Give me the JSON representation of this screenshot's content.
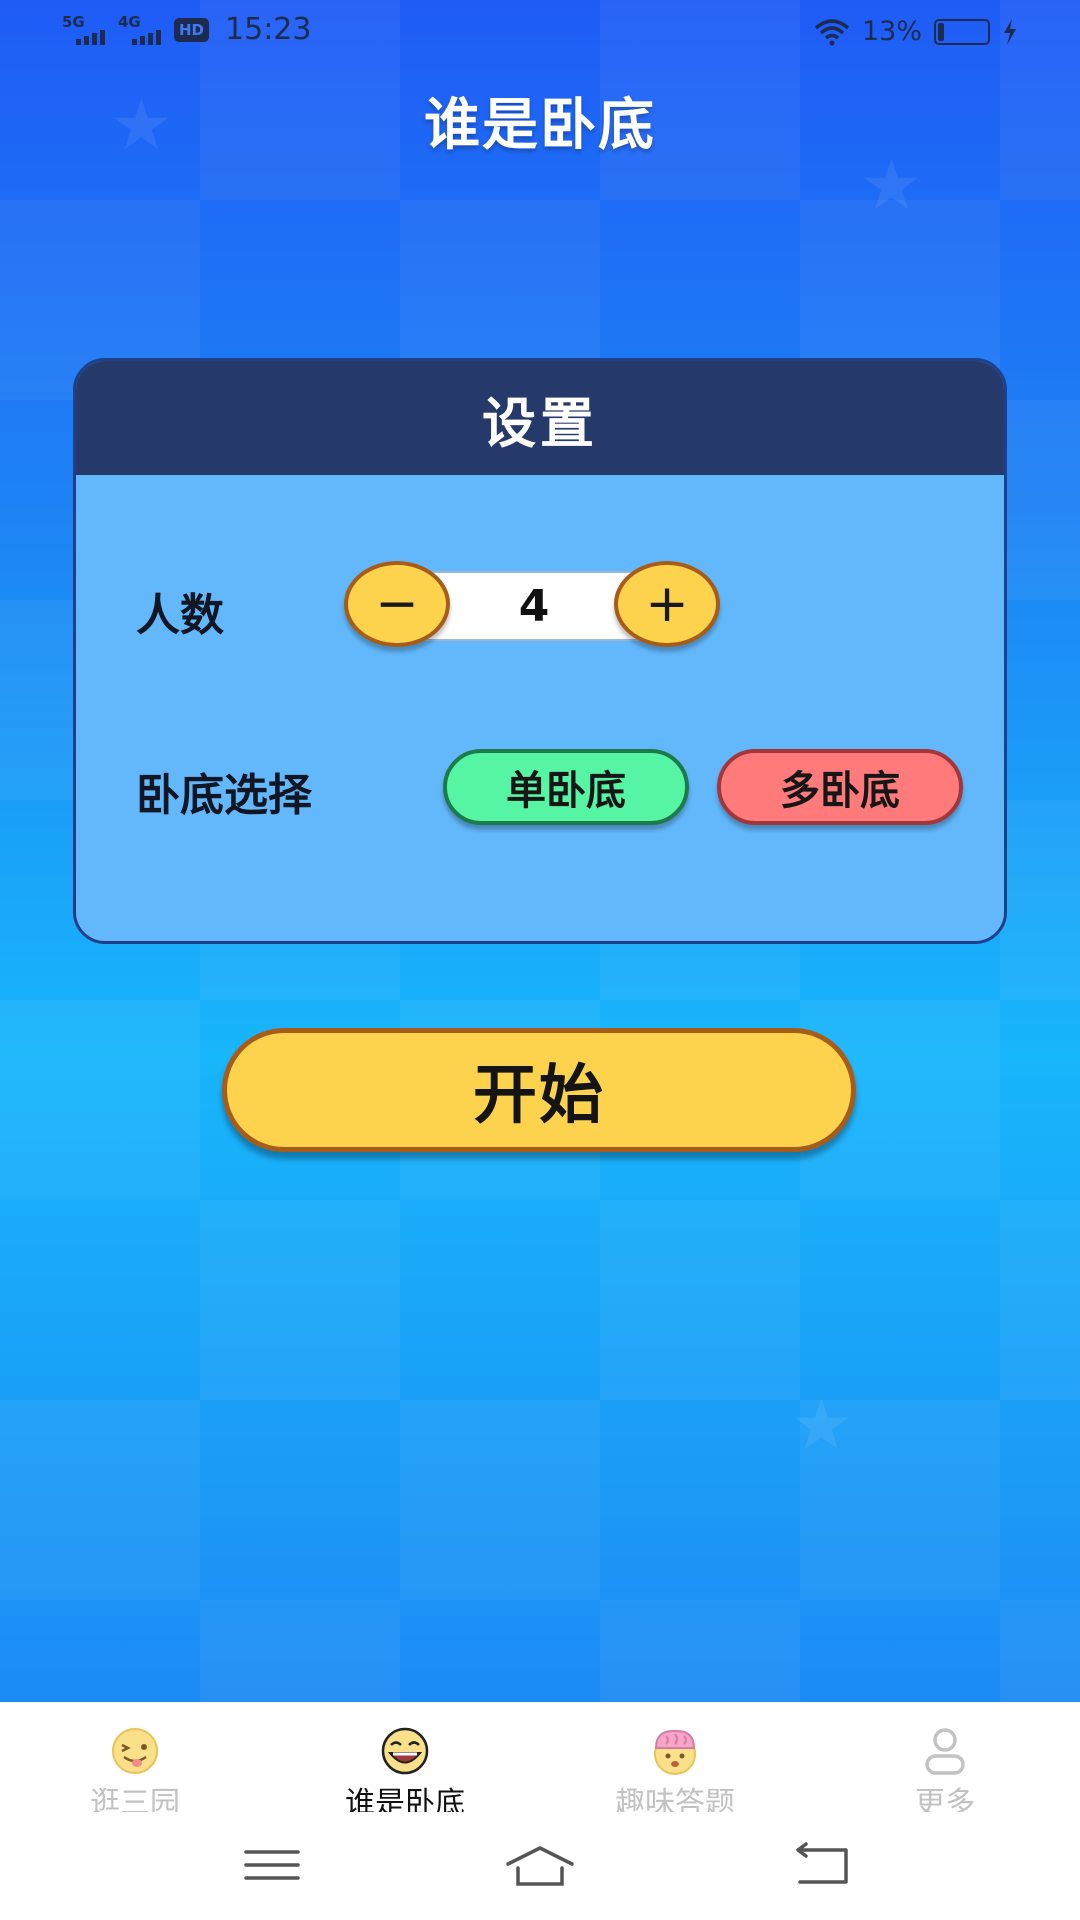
{
  "status_bar": {
    "network_1": "5G",
    "network_2": "4G",
    "hd_badge": "HD",
    "time": "15:23",
    "battery_percent": "13%",
    "battery_level": 0.13,
    "icons": [
      "signal-icon",
      "wifi-icon",
      "battery-icon",
      "charging-icon"
    ]
  },
  "app_title": "谁是卧底",
  "settings": {
    "title": "设置",
    "player_count_label": "人数",
    "player_count_value": "4",
    "decrement_symbol": "−",
    "increment_symbol": "+",
    "spy_mode_label": "卧底选择",
    "spy_mode_options": [
      "单卧底",
      "多卧底"
    ]
  },
  "start_button_label": "开始",
  "tabs": [
    {
      "label": "逛三园",
      "icon": "tongue-face-icon",
      "active": false
    },
    {
      "label": "谁是卧底",
      "icon": "laughing-face-icon",
      "active": true
    },
    {
      "label": "趣味答题",
      "icon": "brain-face-icon",
      "active": false
    },
    {
      "label": "更多",
      "icon": "person-icon",
      "active": false
    }
  ],
  "colors": {
    "background_top": "#1f5cf6",
    "background_mid": "#18b6fb",
    "panel_header": "#253a6b",
    "panel_body": "#62b8fb",
    "button_yellow": "#fdd24c",
    "single_spy_green": "#56f5a4",
    "multi_spy_red": "#ff7b7b"
  },
  "nav_bar": [
    "menu-icon",
    "home-icon",
    "back-icon"
  ]
}
